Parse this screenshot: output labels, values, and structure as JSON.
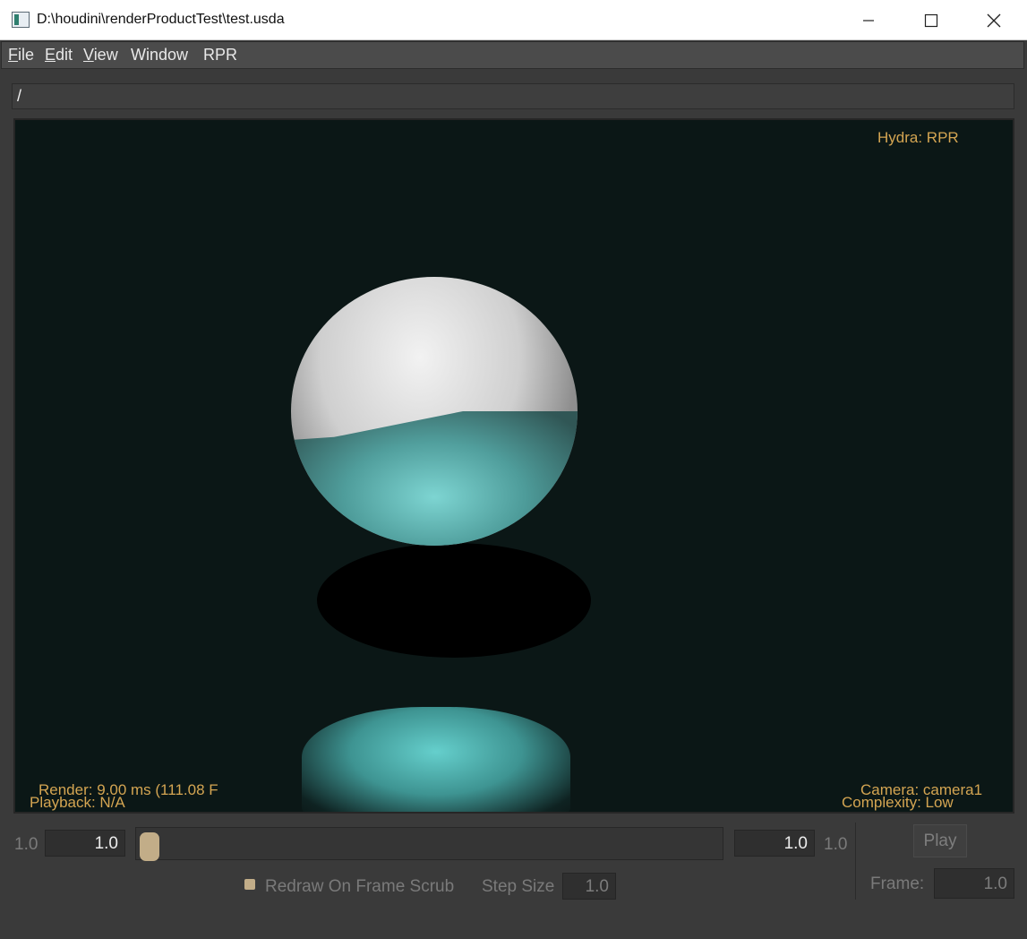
{
  "window": {
    "title": "D:\\houdini\\renderProductTest\\test.usda"
  },
  "menu": {
    "file": "File",
    "edit": "Edit",
    "view": "View",
    "window": "Window",
    "rpr": "RPR"
  },
  "path": {
    "value": "/"
  },
  "viewport": {
    "renderer": "Hydra: RPR",
    "render_stats": "Render: 9.00 ms (111.08 F",
    "playback": "Playback: N/A",
    "camera": "Camera: camera1",
    "complexity": "Complexity: Low"
  },
  "timeline": {
    "start_label": "1.0",
    "start_value": "1.0",
    "end_value": "1.0",
    "end_label": "1.0",
    "slider_position": 0.0,
    "play_label": "Play",
    "frame_label": "Frame:",
    "frame_value": "1.0",
    "redraw_label": "Redraw On Frame Scrub",
    "step_size_label": "Step Size",
    "step_size_value": "1.0"
  },
  "colors": {
    "overlay_text": "#d4a552",
    "accent": "#c2ad88",
    "viewport_bg": "#0b1716"
  }
}
